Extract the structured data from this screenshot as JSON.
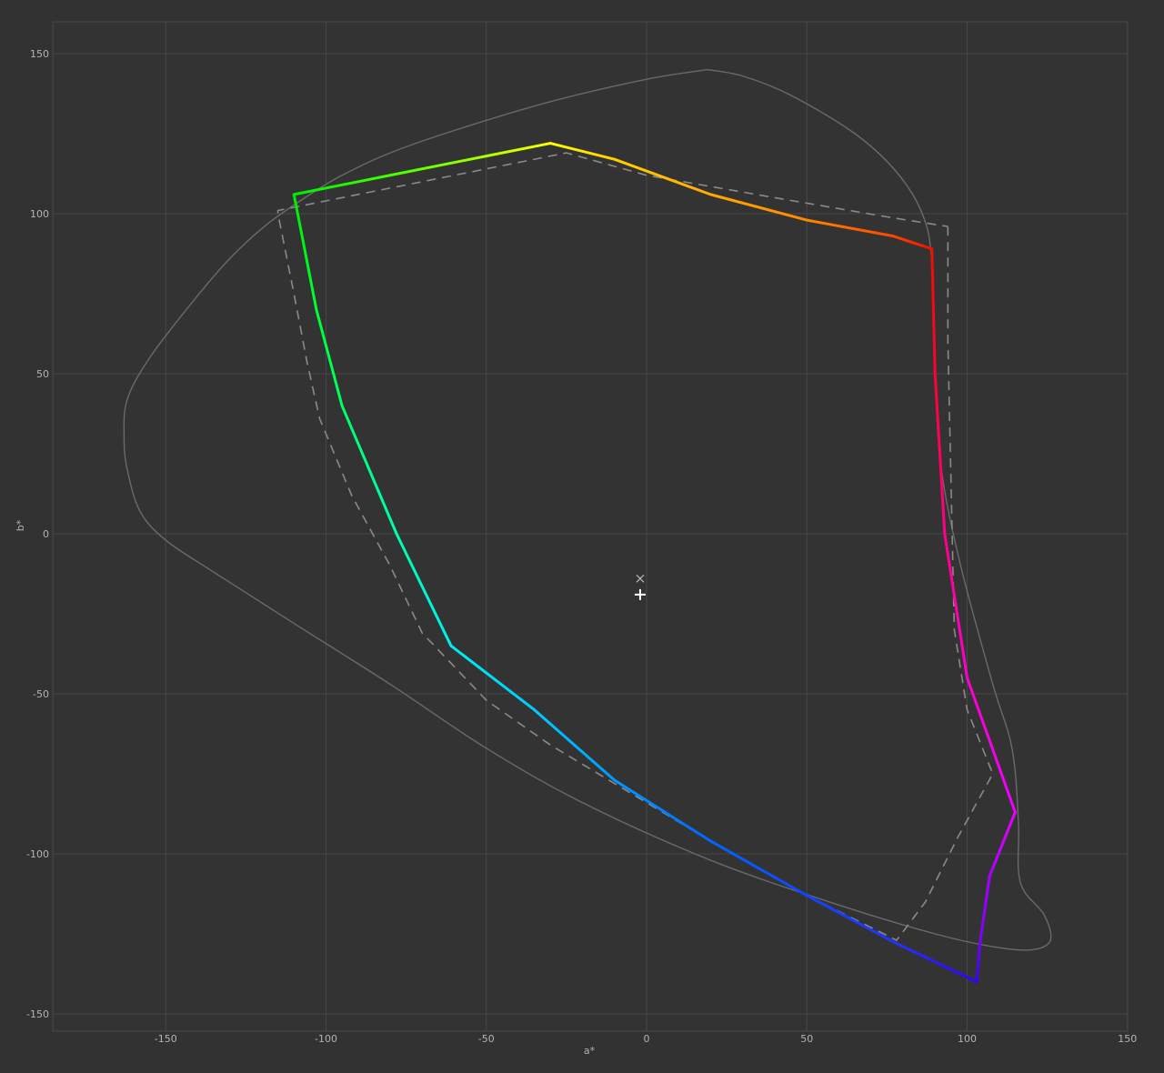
{
  "chart_data": {
    "type": "line",
    "title": "",
    "xlabel": "a*",
    "ylabel": "b*",
    "xlim": [
      -185,
      150
    ],
    "ylim": [
      -155,
      160
    ],
    "xticks": [
      -150,
      -100,
      -50,
      0,
      50,
      100,
      150
    ],
    "yticks": [
      -150,
      -100,
      -50,
      0,
      50,
      100,
      150
    ],
    "xtick_labels": [
      "-150",
      "-100",
      "-50",
      "0",
      "50",
      "100",
      "150"
    ],
    "ytick_labels": [
      "-150",
      "-100",
      "-50",
      "0",
      "50",
      "100",
      "150"
    ],
    "grid": true,
    "colors": {
      "background": "#323232",
      "grid": "#474747",
      "text": "#b4b4b4",
      "reference_outline": "#6a6a6a",
      "reference_dashed": "#8a8a8a"
    },
    "series": [
      {
        "style": "solid-thin-gray",
        "points": [
          [
            19,
            145
          ],
          [
            0,
            142
          ],
          [
            -30,
            135
          ],
          [
            -60,
            126
          ],
          [
            -80,
            119
          ],
          [
            -95,
            112
          ],
          [
            -105,
            106
          ],
          [
            -118,
            97
          ],
          [
            -130,
            86
          ],
          [
            -142,
            72
          ],
          [
            -155,
            55
          ],
          [
            -162,
            42
          ],
          [
            -163,
            30
          ],
          [
            -162,
            20
          ],
          [
            -158,
            7
          ],
          [
            -150,
            -2
          ],
          [
            -135,
            -12
          ],
          [
            -110,
            -28
          ],
          [
            -80,
            -47
          ],
          [
            -50,
            -67
          ],
          [
            -20,
            -84
          ],
          [
            20,
            -102
          ],
          [
            60,
            -116
          ],
          [
            90,
            -125
          ],
          [
            108,
            -129
          ],
          [
            120,
            -130
          ],
          [
            126,
            -127
          ],
          [
            124,
            -119
          ],
          [
            118,
            -112
          ],
          [
            116,
            -105
          ],
          [
            116,
            -90
          ],
          [
            114,
            -67
          ],
          [
            108,
            -47
          ],
          [
            98,
            -10
          ],
          [
            92,
            20
          ],
          [
            90,
            50
          ],
          [
            89,
            85
          ],
          [
            86,
            100
          ],
          [
            78,
            113
          ],
          [
            65,
            125
          ],
          [
            45,
            137
          ],
          [
            30,
            143
          ],
          [
            19,
            145
          ]
        ]
      },
      {
        "style": "dashed-gray",
        "points": [
          [
            94,
            96
          ],
          [
            94,
            60
          ],
          [
            96,
            -30
          ],
          [
            100,
            -55
          ],
          [
            108,
            -75
          ],
          [
            97,
            -95
          ],
          [
            87,
            -115
          ],
          [
            78,
            -127
          ],
          [
            50,
            -113
          ],
          [
            20,
            -96
          ],
          [
            0,
            -84
          ],
          [
            -30,
            -66
          ],
          [
            -50,
            -52
          ],
          [
            -70,
            -31
          ],
          [
            -80,
            -10
          ],
          [
            -92,
            12
          ],
          [
            -102,
            36
          ],
          [
            -106,
            54
          ],
          [
            -110,
            75
          ],
          [
            -115,
            100
          ],
          [
            -115,
            101
          ],
          [
            -25,
            119
          ],
          [
            0,
            112
          ],
          [
            40,
            105
          ],
          [
            75,
            99
          ],
          [
            94,
            96
          ]
        ]
      },
      {
        "style": "gradient-hue",
        "points": [
          {
            "a": -30,
            "b": 122,
            "color": "#ffff00"
          },
          {
            "a": -10,
            "b": 117,
            "color": "#ffd000"
          },
          {
            "a": 20,
            "b": 106,
            "color": "#ffaa00"
          },
          {
            "a": 50,
            "b": 98,
            "color": "#ff8800"
          },
          {
            "a": 77,
            "b": 93,
            "color": "#ff4400"
          },
          {
            "a": 89,
            "b": 89,
            "color": "#ee1100"
          },
          {
            "a": 90,
            "b": 50,
            "color": "#ff0033"
          },
          {
            "a": 93,
            "b": 0,
            "color": "#ff0088"
          },
          {
            "a": 100,
            "b": -45,
            "color": "#ff00cc"
          },
          {
            "a": 115,
            "b": -87,
            "color": "#ee00ff"
          },
          {
            "a": 107,
            "b": -107,
            "color": "#aa00ff"
          },
          {
            "a": 104,
            "b": -128,
            "color": "#7700ff"
          },
          {
            "a": 103,
            "b": -140,
            "color": "#3300ff"
          },
          {
            "a": 78,
            "b": -128,
            "color": "#2233ff"
          },
          {
            "a": 50,
            "b": -113,
            "color": "#1144ff"
          },
          {
            "a": 20,
            "b": -96,
            "color": "#0066ff"
          },
          {
            "a": -10,
            "b": -77,
            "color": "#0099ff"
          },
          {
            "a": -35,
            "b": -55,
            "color": "#00ccff"
          },
          {
            "a": -61,
            "b": -35,
            "color": "#00eeee"
          },
          {
            "a": -78,
            "b": 0,
            "color": "#00ffaa"
          },
          {
            "a": -95,
            "b": 40,
            "color": "#00ff66"
          },
          {
            "a": -103,
            "b": 70,
            "color": "#00ff33"
          },
          {
            "a": -110,
            "b": 106,
            "color": "#00ee00"
          },
          {
            "a": -80,
            "b": 112,
            "color": "#44ff00"
          },
          {
            "a": -50,
            "b": 118,
            "color": "#aaff00"
          },
          {
            "a": -30,
            "b": 122,
            "color": "#ffff00"
          }
        ]
      }
    ],
    "markers": [
      {
        "symbol": "x",
        "a": -2,
        "b": -14,
        "color": "#b4b4b4"
      },
      {
        "symbol": "+",
        "a": -2,
        "b": -19,
        "color": "#ffffff"
      }
    ]
  }
}
